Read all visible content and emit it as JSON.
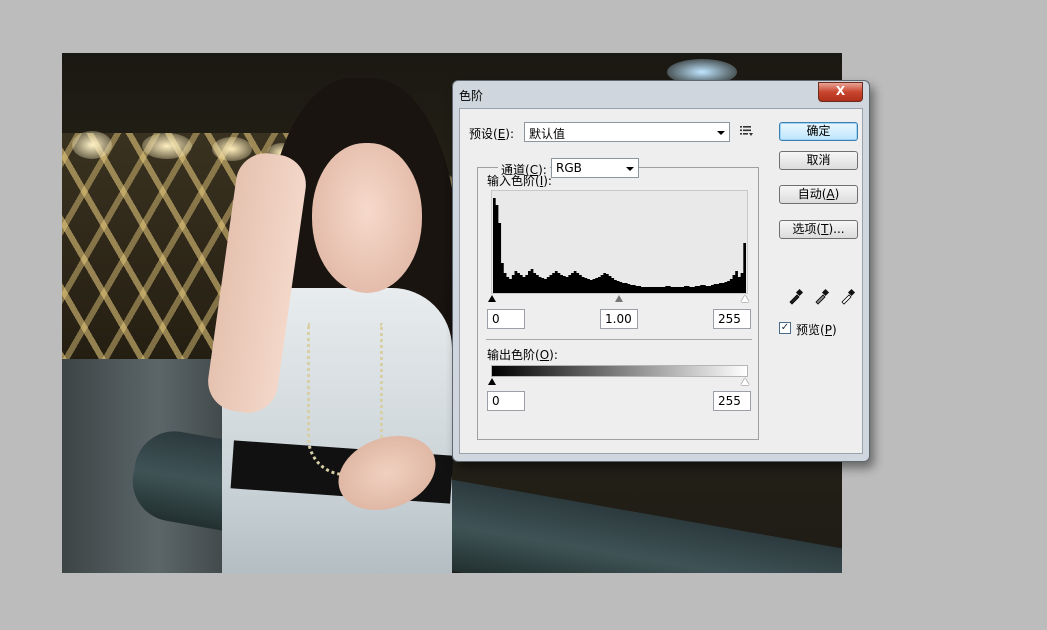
{
  "dialog": {
    "title": "色阶",
    "close_label": "X",
    "preset": {
      "label": "预设(E):",
      "label_prefix": "预设(",
      "label_key": "E",
      "label_suffix": "):",
      "value": "默认值"
    },
    "channel": {
      "label_prefix": "通道(",
      "label_key": "C",
      "label_suffix": "):",
      "value": "RGB"
    },
    "input_levels": {
      "label_prefix": "输入色阶(",
      "label_key": "I",
      "label_suffix": "):",
      "black": "0",
      "gamma": "1.00",
      "white": "255"
    },
    "output_levels": {
      "label_prefix": "输出色阶(",
      "label_key": "O",
      "label_suffix": "):",
      "black": "0",
      "white": "255"
    },
    "buttons": {
      "ok": "确定",
      "cancel": "取消",
      "auto_prefix": "自动(",
      "auto_key": "A",
      "auto_suffix": ")",
      "options_prefix": "选项(",
      "options_key": "T",
      "options_suffix": ")..."
    },
    "preview": {
      "label_prefix": "预览(",
      "label_key": "P",
      "label_suffix": ")",
      "checked": true
    }
  },
  "icons": [
    "eyedropper-black-icon",
    "eyedropper-gray-icon",
    "eyedropper-white-icon",
    "preset-options-icon"
  ],
  "histogram": {
    "bins": [
      95,
      88,
      70,
      30,
      20,
      16,
      14,
      18,
      22,
      20,
      18,
      16,
      18,
      22,
      24,
      20,
      18,
      16,
      15,
      14,
      16,
      18,
      20,
      22,
      20,
      18,
      17,
      16,
      18,
      20,
      22,
      20,
      18,
      16,
      15,
      14,
      13,
      14,
      15,
      16,
      18,
      20,
      19,
      17,
      15,
      13,
      12,
      11,
      10,
      10,
      9,
      8,
      8,
      7,
      7,
      6,
      6,
      6,
      6,
      6,
      6,
      6,
      6,
      6,
      7,
      7,
      6,
      6,
      6,
      6,
      6,
      7,
      7,
      6,
      6,
      7,
      7,
      8,
      8,
      7,
      7,
      8,
      9,
      9,
      10,
      10,
      11,
      12,
      14,
      18,
      22,
      16,
      20,
      50
    ],
    "max": 100
  }
}
